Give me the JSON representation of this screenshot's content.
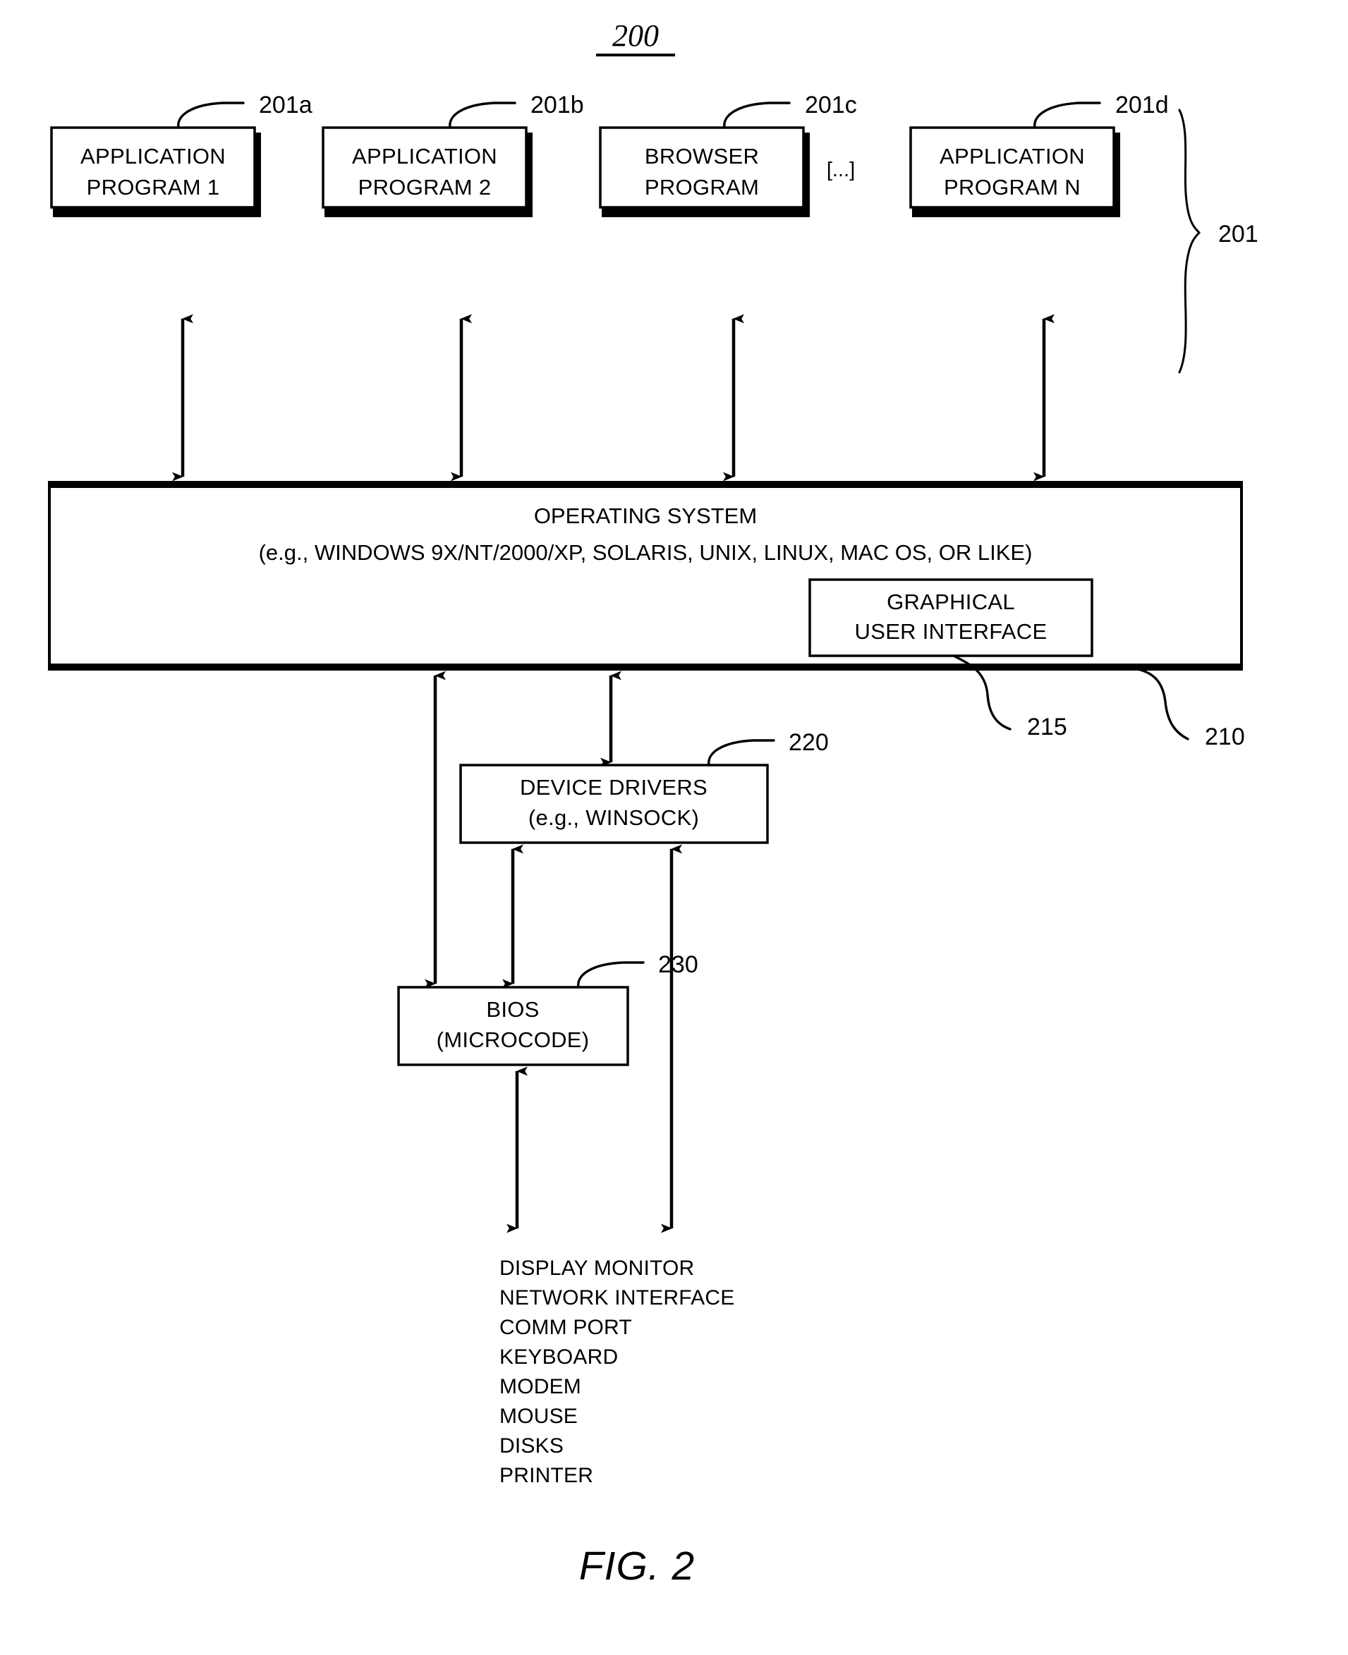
{
  "figure": {
    "number_label": "200",
    "caption": "FIG. 2"
  },
  "app_layer": {
    "group_ref": "201",
    "ellipsis": "[...]",
    "boxes": [
      {
        "line1": "APPLICATION",
        "line2": "PROGRAM 1",
        "ref": "201a"
      },
      {
        "line1": "APPLICATION",
        "line2": "PROGRAM 2",
        "ref": "201b"
      },
      {
        "line1": "BROWSER",
        "line2": "PROGRAM",
        "ref": "201c"
      },
      {
        "line1": "APPLICATION",
        "line2": "PROGRAM N",
        "ref": "201d"
      }
    ]
  },
  "os_layer": {
    "title": "OPERATING SYSTEM",
    "subtitle": "(e.g., WINDOWS 9X/NT/2000/XP, SOLARIS, UNIX, LINUX, MAC OS, OR LIKE)",
    "ref": "210",
    "gui": {
      "line1": "GRAPHICAL",
      "line2": "USER INTERFACE",
      "ref": "215"
    }
  },
  "drivers_layer": {
    "line1": "DEVICE DRIVERS",
    "line2": "(e.g., WINSOCK)",
    "ref": "220"
  },
  "bios_layer": {
    "line1": "BIOS",
    "line2": "(MICROCODE)",
    "ref": "230"
  },
  "devices": [
    "DISPLAY MONITOR",
    "NETWORK INTERFACE",
    "COMM PORT",
    "KEYBOARD",
    "MODEM",
    "MOUSE",
    "DISKS",
    "PRINTER"
  ]
}
